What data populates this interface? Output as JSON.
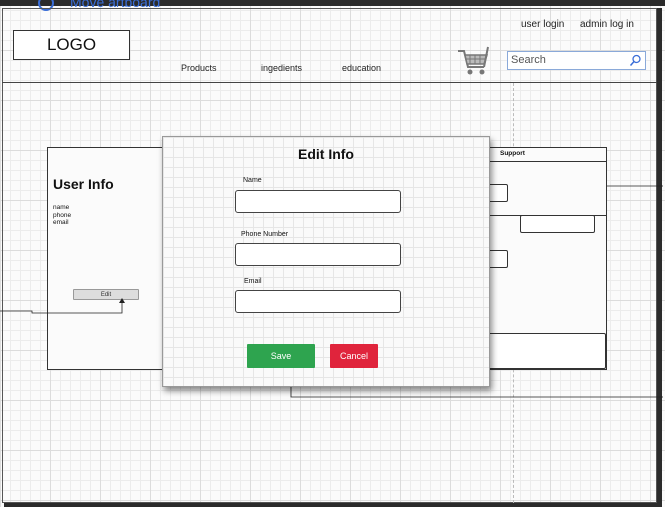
{
  "topbar": {
    "move_link": "Move artboard"
  },
  "header": {
    "logo": "LOGO",
    "nav": {
      "products": "Products",
      "ingredients": "ingedients",
      "education": "education"
    },
    "auth": {
      "user_login": "user login",
      "admin_login": "admin log in"
    },
    "search": {
      "placeholder": "Search"
    },
    "cart_icon": "shopping-cart-icon"
  },
  "user_info_card": {
    "title": "User Info",
    "fields": [
      "name",
      "phone",
      "email"
    ],
    "edit_button": "Edit"
  },
  "support_card": {
    "title": "Support"
  },
  "modal": {
    "title": "Edit Info",
    "fields": [
      {
        "label": "Name",
        "value": ""
      },
      {
        "label": "Phone Number",
        "value": ""
      },
      {
        "label": "Email",
        "value": ""
      }
    ],
    "save_button": "Save",
    "cancel_button": "Cancel"
  },
  "colors": {
    "save": "#2ea44f",
    "cancel": "#e0243c",
    "search_border": "#8aa9d9"
  }
}
